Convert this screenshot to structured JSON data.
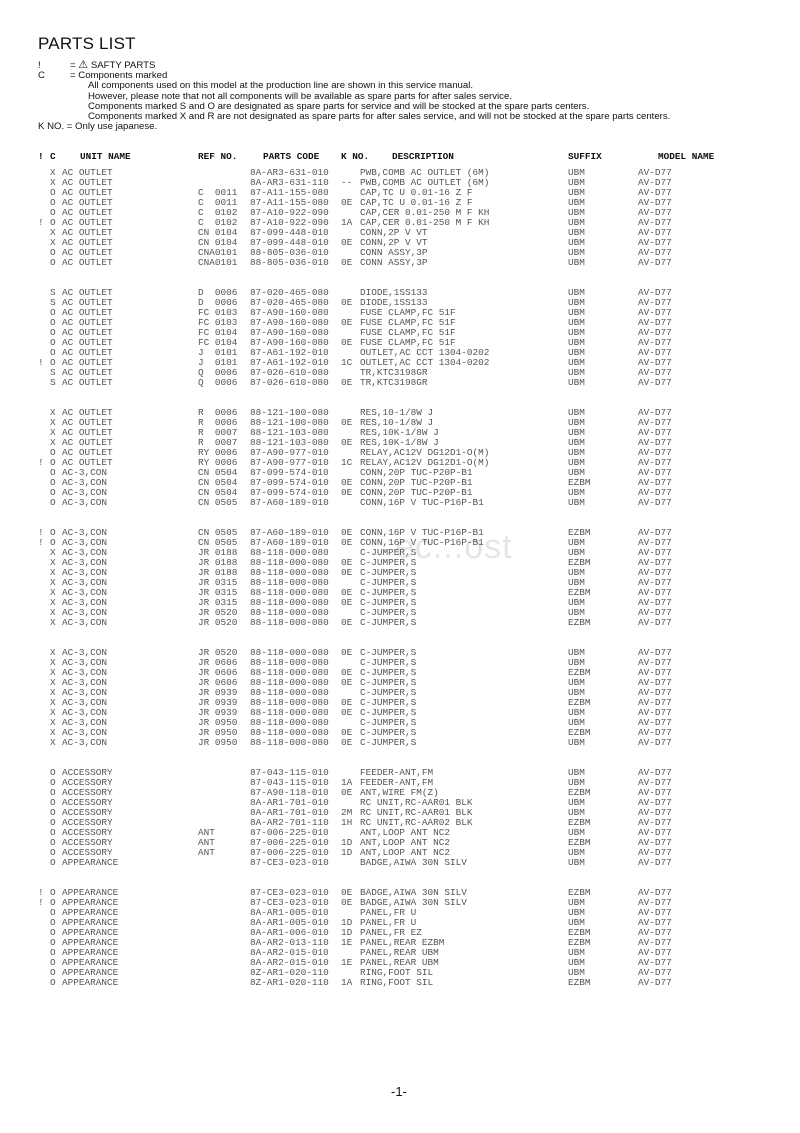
{
  "title": "PARTS LIST",
  "legend": {
    "safety_symbol": "!",
    "safety_def_prefix": "= ",
    "safety_icon": "warning-triangle",
    "safety_glyph": "⚠",
    "safety_label": "SAFTY PARTS",
    "c_symbol": "C",
    "c_def": "= Components marked",
    "notes": [
      "All components used on this model at the production line are shown in this service manual.",
      "However, please note that not all components will be available as spare parts for after sales service.",
      "Components marked S and O are designated as spare parts for service and will be stocked at the spare parts centers.",
      "Components marked X and R are not designated as spare parts for after sales service, and will not be stocked at the spare parts centers."
    ],
    "kno_note": "K NO. = Only use japanese."
  },
  "columns": {
    "bang": "!",
    "c": "C",
    "unit_name": "UNIT NAME",
    "ref_no": "REF NO.",
    "parts_code": "PARTS CODE",
    "k_no": "K NO.",
    "description": "DESCRIPTION",
    "suffix": "SUFFIX",
    "model_name": "MODEL NAME"
  },
  "groups": [
    {
      "rows": [
        {
          "bang": "",
          "c": "X",
          "unit": "AC OUTLET",
          "ref": "",
          "pc": "8A-AR3-631-010",
          "kno": "",
          "desc": "PWB,COMB AC OUTLET (6M)",
          "suf": "UBM",
          "model": "AV-D77"
        },
        {
          "bang": "",
          "c": "X",
          "unit": "AC OUTLET",
          "ref": "",
          "pc": "8A-AR3-631-110",
          "kno": "--",
          "desc": "PWB,COMB AC OUTLET (6M)",
          "suf": "UBM",
          "model": "AV-D77"
        },
        {
          "bang": "",
          "c": "O",
          "unit": "AC OUTLET",
          "ref": "C  0011",
          "pc": "87-A11-155-080",
          "kno": "",
          "desc": "CAP,TC U 0.01-16 Z F",
          "suf": "UBM",
          "model": "AV-D77"
        },
        {
          "bang": "",
          "c": "O",
          "unit": "AC OUTLET",
          "ref": "C  0011",
          "pc": "87-A11-155-080",
          "kno": "0E",
          "desc": "CAP,TC U 0.01-16 Z F",
          "suf": "UBM",
          "model": "AV-D77"
        },
        {
          "bang": "",
          "c": "O",
          "unit": "AC OUTLET",
          "ref": "C  0102",
          "pc": "87-A10-922-090",
          "kno": "",
          "desc": "CAP,CER 0.01-250 M F KH",
          "suf": "UBM",
          "model": "AV-D77"
        },
        {
          "bang": "!",
          "c": "O",
          "unit": "AC OUTLET",
          "ref": "C  0102",
          "pc": "87-A10-922-090",
          "kno": "1A",
          "desc": "CAP,CER 0.01-250 M F KH",
          "suf": "UBM",
          "model": "AV-D77"
        },
        {
          "bang": "",
          "c": "X",
          "unit": "AC OUTLET",
          "ref": "CN 0104",
          "pc": "87-099-448-010",
          "kno": "",
          "desc": "CONN,2P V VT",
          "suf": "UBM",
          "model": "AV-D77"
        },
        {
          "bang": "",
          "c": "X",
          "unit": "AC OUTLET",
          "ref": "CN 0104",
          "pc": "87-099-448-010",
          "kno": "0E",
          "desc": "CONN,2P V VT",
          "suf": "UBM",
          "model": "AV-D77"
        },
        {
          "bang": "",
          "c": "O",
          "unit": "AC OUTLET",
          "ref": "CNA0101",
          "pc": "88-805-036-010",
          "kno": "",
          "desc": "CONN ASSY,3P",
          "suf": "UBM",
          "model": "AV-D77"
        },
        {
          "bang": "",
          "c": "O",
          "unit": "AC OUTLET",
          "ref": "CNA0101",
          "pc": "88-805-036-010",
          "kno": "0E",
          "desc": "CONN ASSY,3P",
          "suf": "UBM",
          "model": "AV-D77"
        }
      ]
    },
    {
      "rows": [
        {
          "bang": "",
          "c": "S",
          "unit": "AC OUTLET",
          "ref": "D  0006",
          "pc": "87-020-465-080",
          "kno": "",
          "desc": "DIODE,1SS133",
          "suf": "UBM",
          "model": "AV-D77"
        },
        {
          "bang": "",
          "c": "S",
          "unit": "AC OUTLET",
          "ref": "D  0006",
          "pc": "87-020-465-080",
          "kno": "0E",
          "desc": "DIODE,1SS133",
          "suf": "UBM",
          "model": "AV-D77"
        },
        {
          "bang": "",
          "c": "O",
          "unit": "AC OUTLET",
          "ref": "FC 0103",
          "pc": "87-A90-160-080",
          "kno": "",
          "desc": "FUSE CLAMP,FC 51F",
          "suf": "UBM",
          "model": "AV-D77"
        },
        {
          "bang": "",
          "c": "O",
          "unit": "AC OUTLET",
          "ref": "FC 0103",
          "pc": "87-A90-160-080",
          "kno": "0E",
          "desc": "FUSE CLAMP,FC 51F",
          "suf": "UBM",
          "model": "AV-D77"
        },
        {
          "bang": "",
          "c": "O",
          "unit": "AC OUTLET",
          "ref": "FC 0104",
          "pc": "87-A90-160-080",
          "kno": "",
          "desc": "FUSE CLAMP,FC 51F",
          "suf": "UBM",
          "model": "AV-D77"
        },
        {
          "bang": "",
          "c": "O",
          "unit": "AC OUTLET",
          "ref": "FC 0104",
          "pc": "87-A90-160-080",
          "kno": "0E",
          "desc": "FUSE CLAMP,FC 51F",
          "suf": "UBM",
          "model": "AV-D77"
        },
        {
          "bang": "",
          "c": "O",
          "unit": "AC OUTLET",
          "ref": "J  0101",
          "pc": "87-A61-192-010",
          "kno": "",
          "desc": "OUTLET,AC CCT 1304-0202",
          "suf": "UBM",
          "model": "AV-D77"
        },
        {
          "bang": "!",
          "c": "O",
          "unit": "AC OUTLET",
          "ref": "J  0101",
          "pc": "87-A61-192-010",
          "kno": "1C",
          "desc": "OUTLET,AC CCT 1304-0202",
          "suf": "UBM",
          "model": "AV-D77"
        },
        {
          "bang": "",
          "c": "S",
          "unit": "AC OUTLET",
          "ref": "Q  0006",
          "pc": "87-026-610-080",
          "kno": "",
          "desc": "TR,KTC3198GR",
          "suf": "UBM",
          "model": "AV-D77"
        },
        {
          "bang": "",
          "c": "S",
          "unit": "AC OUTLET",
          "ref": "Q  0006",
          "pc": "87-026-610-080",
          "kno": "0E",
          "desc": "TR,KTC3198GR",
          "suf": "UBM",
          "model": "AV-D77"
        }
      ]
    },
    {
      "rows": [
        {
          "bang": "",
          "c": "X",
          "unit": "AC OUTLET",
          "ref": "R  0006",
          "pc": "88-121-100-080",
          "kno": "",
          "desc": "RES,10-1/8W J",
          "suf": "UBM",
          "model": "AV-D77"
        },
        {
          "bang": "",
          "c": "X",
          "unit": "AC OUTLET",
          "ref": "R  0006",
          "pc": "88-121-100-080",
          "kno": "0E",
          "desc": "RES,10-1/8W J",
          "suf": "UBM",
          "model": "AV-D77"
        },
        {
          "bang": "",
          "c": "X",
          "unit": "AC OUTLET",
          "ref": "R  0007",
          "pc": "88-121-103-080",
          "kno": "",
          "desc": "RES,10K-1/8W J",
          "suf": "UBM",
          "model": "AV-D77"
        },
        {
          "bang": "",
          "c": "X",
          "unit": "AC OUTLET",
          "ref": "R  0007",
          "pc": "88-121-103-080",
          "kno": "0E",
          "desc": "RES,10K-1/8W J",
          "suf": "UBM",
          "model": "AV-D77"
        },
        {
          "bang": "",
          "c": "O",
          "unit": "AC OUTLET",
          "ref": "RY 0006",
          "pc": "87-A90-977-010",
          "kno": "",
          "desc": "RELAY,AC12V DG12D1-O(M)",
          "suf": "UBM",
          "model": "AV-D77"
        },
        {
          "bang": "!",
          "c": "O",
          "unit": "AC OUTLET",
          "ref": "RY 0006",
          "pc": "87-A90-977-010",
          "kno": "1C",
          "desc": "RELAY,AC12V DG12D1-O(M)",
          "suf": "UBM",
          "model": "AV-D77"
        },
        {
          "bang": "",
          "c": "O",
          "unit": "AC-3,CON",
          "ref": "CN 0504",
          "pc": "87-099-574-010",
          "kno": "",
          "desc": "CONN,20P TUC-P20P-B1",
          "suf": "UBM",
          "model": "AV-D77"
        },
        {
          "bang": "",
          "c": "O",
          "unit": "AC-3,CON",
          "ref": "CN 0504",
          "pc": "87-099-574-010",
          "kno": "0E",
          "desc": "CONN,20P TUC-P20P-B1",
          "suf": "EZBM",
          "model": "AV-D77"
        },
        {
          "bang": "",
          "c": "O",
          "unit": "AC-3,CON",
          "ref": "CN 0504",
          "pc": "87-099-574-010",
          "kno": "0E",
          "desc": "CONN,20P TUC-P20P-B1",
          "suf": "UBM",
          "model": "AV-D77"
        },
        {
          "bang": "",
          "c": "O",
          "unit": "AC-3,CON",
          "ref": "CN 0505",
          "pc": "87-A60-189-010",
          "kno": "",
          "desc": "CONN,16P V TUC-P16P-B1",
          "suf": "UBM",
          "model": "AV-D77"
        }
      ]
    },
    {
      "rows": [
        {
          "bang": "!",
          "c": "O",
          "unit": "AC-3,CON",
          "ref": "CN 0505",
          "pc": "87-A60-189-010",
          "kno": "0E",
          "desc": "CONN,16P V TUC-P16P-B1",
          "suf": "EZBM",
          "model": "AV-D77"
        },
        {
          "bang": "!",
          "c": "O",
          "unit": "AC-3,CON",
          "ref": "CN 0505",
          "pc": "87-A60-189-010",
          "kno": "0E",
          "desc": "CONN,16P V TUC-P16P-B1",
          "suf": "UBM",
          "model": "AV-D77"
        },
        {
          "bang": "",
          "c": "X",
          "unit": "AC-3,CON",
          "ref": "JR 0188",
          "pc": "88-118-000-080",
          "kno": "",
          "desc": "C-JUMPER,S",
          "suf": "UBM",
          "model": "AV-D77"
        },
        {
          "bang": "",
          "c": "X",
          "unit": "AC-3,CON",
          "ref": "JR 0188",
          "pc": "88-118-000-080",
          "kno": "0E",
          "desc": "C-JUMPER,S",
          "suf": "EZBM",
          "model": "AV-D77"
        },
        {
          "bang": "",
          "c": "X",
          "unit": "AC-3,CON",
          "ref": "JR 0188",
          "pc": "88-118-000-080",
          "kno": "0E",
          "desc": "C-JUMPER,S",
          "suf": "UBM",
          "model": "AV-D77"
        },
        {
          "bang": "",
          "c": "X",
          "unit": "AC-3,CON",
          "ref": "JR 0315",
          "pc": "88-118-000-080",
          "kno": "",
          "desc": "C-JUMPER,S",
          "suf": "UBM",
          "model": "AV-D77"
        },
        {
          "bang": "",
          "c": "X",
          "unit": "AC-3,CON",
          "ref": "JR 0315",
          "pc": "88-118-000-080",
          "kno": "0E",
          "desc": "C-JUMPER,S",
          "suf": "EZBM",
          "model": "AV-D77"
        },
        {
          "bang": "",
          "c": "X",
          "unit": "AC-3,CON",
          "ref": "JR 0315",
          "pc": "88-118-000-080",
          "kno": "0E",
          "desc": "C-JUMPER,S",
          "suf": "UBM",
          "model": "AV-D77"
        },
        {
          "bang": "",
          "c": "X",
          "unit": "AC-3,CON",
          "ref": "JR 0520",
          "pc": "88-118-000-080",
          "kno": "",
          "desc": "C-JUMPER,S",
          "suf": "UBM",
          "model": "AV-D77"
        },
        {
          "bang": "",
          "c": "X",
          "unit": "AC-3,CON",
          "ref": "JR 0520",
          "pc": "88-118-000-080",
          "kno": "0E",
          "desc": "C-JUMPER,S",
          "suf": "EZBM",
          "model": "AV-D77"
        }
      ]
    },
    {
      "rows": [
        {
          "bang": "",
          "c": "X",
          "unit": "AC-3,CON",
          "ref": "JR 0520",
          "pc": "88-118-000-080",
          "kno": "0E",
          "desc": "C-JUMPER,S",
          "suf": "UBM",
          "model": "AV-D77"
        },
        {
          "bang": "",
          "c": "X",
          "unit": "AC-3,CON",
          "ref": "JR 0606",
          "pc": "88-118-000-080",
          "kno": "",
          "desc": "C-JUMPER,S",
          "suf": "UBM",
          "model": "AV-D77"
        },
        {
          "bang": "",
          "c": "X",
          "unit": "AC-3,CON",
          "ref": "JR 0606",
          "pc": "88-118-000-080",
          "kno": "0E",
          "desc": "C-JUMPER,S",
          "suf": "EZBM",
          "model": "AV-D77"
        },
        {
          "bang": "",
          "c": "X",
          "unit": "AC-3,CON",
          "ref": "JR 0606",
          "pc": "88-118-000-080",
          "kno": "0E",
          "desc": "C-JUMPER,S",
          "suf": "UBM",
          "model": "AV-D77"
        },
        {
          "bang": "",
          "c": "X",
          "unit": "AC-3,CON",
          "ref": "JR 0939",
          "pc": "88-118-000-080",
          "kno": "",
          "desc": "C-JUMPER,S",
          "suf": "UBM",
          "model": "AV-D77"
        },
        {
          "bang": "",
          "c": "X",
          "unit": "AC-3,CON",
          "ref": "JR 0939",
          "pc": "88-118-000-080",
          "kno": "0E",
          "desc": "C-JUMPER,S",
          "suf": "EZBM",
          "model": "AV-D77"
        },
        {
          "bang": "",
          "c": "X",
          "unit": "AC-3,CON",
          "ref": "JR 0939",
          "pc": "88-118-000-080",
          "kno": "0E",
          "desc": "C-JUMPER,S",
          "suf": "UBM",
          "model": "AV-D77"
        },
        {
          "bang": "",
          "c": "X",
          "unit": "AC-3,CON",
          "ref": "JR 0950",
          "pc": "88-118-000-080",
          "kno": "",
          "desc": "C-JUMPER,S",
          "suf": "UBM",
          "model": "AV-D77"
        },
        {
          "bang": "",
          "c": "X",
          "unit": "AC-3,CON",
          "ref": "JR 0950",
          "pc": "88-118-000-080",
          "kno": "0E",
          "desc": "C-JUMPER,S",
          "suf": "EZBM",
          "model": "AV-D77"
        },
        {
          "bang": "",
          "c": "X",
          "unit": "AC-3,CON",
          "ref": "JR 0950",
          "pc": "88-118-000-080",
          "kno": "0E",
          "desc": "C-JUMPER,S",
          "suf": "UBM",
          "model": "AV-D77"
        }
      ]
    },
    {
      "rows": [
        {
          "bang": "",
          "c": "O",
          "unit": "ACCESSORY",
          "ref": "",
          "pc": "87-043-115-010",
          "kno": "",
          "desc": "FEEDER-ANT,FM",
          "suf": "UBM",
          "model": "AV-D77"
        },
        {
          "bang": "",
          "c": "O",
          "unit": "ACCESSORY",
          "ref": "",
          "pc": "87-043-115-010",
          "kno": "1A",
          "desc": "FEEDER-ANT,FM",
          "suf": "UBM",
          "model": "AV-D77"
        },
        {
          "bang": "",
          "c": "O",
          "unit": "ACCESSORY",
          "ref": "",
          "pc": "87-A90-118-010",
          "kno": "0E",
          "desc": "ANT,WIRE FM(Z)",
          "suf": "EZBM",
          "model": "AV-D77"
        },
        {
          "bang": "",
          "c": "O",
          "unit": "ACCESSORY",
          "ref": "",
          "pc": "8A-AR1-701-010",
          "kno": "",
          "desc": "RC UNIT,RC-AAR01 BLK",
          "suf": "UBM",
          "model": "AV-D77"
        },
        {
          "bang": "",
          "c": "O",
          "unit": "ACCESSORY",
          "ref": "",
          "pc": "8A-AR1-701-010",
          "kno": "2M",
          "desc": "RC UNIT,RC-AAR01 BLK",
          "suf": "UBM",
          "model": "AV-D77"
        },
        {
          "bang": "",
          "c": "O",
          "unit": "ACCESSORY",
          "ref": "",
          "pc": "8A-AR2-701-110",
          "kno": "1H",
          "desc": "RC UNIT,RC-AAR02 BLK",
          "suf": "EZBM",
          "model": "AV-D77"
        },
        {
          "bang": "",
          "c": "O",
          "unit": "ACCESSORY",
          "ref": "ANT",
          "pc": "87-006-225-010",
          "kno": "",
          "desc": "ANT,LOOP ANT NC2",
          "suf": "UBM",
          "model": "AV-D77"
        },
        {
          "bang": "",
          "c": "O",
          "unit": "ACCESSORY",
          "ref": "ANT",
          "pc": "87-006-225-010",
          "kno": "1D",
          "desc": "ANT,LOOP ANT NC2",
          "suf": "EZBM",
          "model": "AV-D77"
        },
        {
          "bang": "",
          "c": "O",
          "unit": "ACCESSORY",
          "ref": "ANT",
          "pc": "87-006-225-010",
          "kno": "1D",
          "desc": "ANT,LOOP ANT NC2",
          "suf": "UBM",
          "model": "AV-D77"
        },
        {
          "bang": "",
          "c": "O",
          "unit": "APPEARANCE",
          "ref": "",
          "pc": "87-CE3-023-010",
          "kno": "",
          "desc": "BADGE,AIWA 30N SILV",
          "suf": "UBM",
          "model": "AV-D77"
        }
      ]
    },
    {
      "rows": [
        {
          "bang": "!",
          "c": "O",
          "unit": "APPEARANCE",
          "ref": "",
          "pc": "87-CE3-023-010",
          "kno": "0E",
          "desc": "BADGE,AIWA 30N SILV",
          "suf": "EZBM",
          "model": "AV-D77"
        },
        {
          "bang": "!",
          "c": "O",
          "unit": "APPEARANCE",
          "ref": "",
          "pc": "87-CE3-023-010",
          "kno": "0E",
          "desc": "BADGE,AIWA 30N SILV",
          "suf": "UBM",
          "model": "AV-D77"
        },
        {
          "bang": "",
          "c": "O",
          "unit": "APPEARANCE",
          "ref": "",
          "pc": "8A-AR1-005-010",
          "kno": "",
          "desc": "PANEL,FR U",
          "suf": "UBM",
          "model": "AV-D77"
        },
        {
          "bang": "",
          "c": "O",
          "unit": "APPEARANCE",
          "ref": "",
          "pc": "8A-AR1-005-010",
          "kno": "1D",
          "desc": "PANEL,FR U",
          "suf": "UBM",
          "model": "AV-D77"
        },
        {
          "bang": "",
          "c": "O",
          "unit": "APPEARANCE",
          "ref": "",
          "pc": "8A-AR1-006-010",
          "kno": "1D",
          "desc": "PANEL,FR EZ",
          "suf": "EZBM",
          "model": "AV-D77"
        },
        {
          "bang": "",
          "c": "O",
          "unit": "APPEARANCE",
          "ref": "",
          "pc": "8A-AR2-013-110",
          "kno": "1E",
          "desc": "PANEL,REAR EZBM",
          "suf": "EZBM",
          "model": "AV-D77"
        },
        {
          "bang": "",
          "c": "O",
          "unit": "APPEARANCE",
          "ref": "",
          "pc": "8A-AR2-015-010",
          "kno": "",
          "desc": "PANEL,REAR UBM",
          "suf": "UBM",
          "model": "AV-D77"
        },
        {
          "bang": "",
          "c": "O",
          "unit": "APPEARANCE",
          "ref": "",
          "pc": "8A-AR2-015-010",
          "kno": "1E",
          "desc": "PANEL,REAR UBM",
          "suf": "UBM",
          "model": "AV-D77"
        },
        {
          "bang": "",
          "c": "O",
          "unit": "APPEARANCE",
          "ref": "",
          "pc": "8Z-AR1-020-110",
          "kno": "",
          "desc": "RING,FOOT SIL",
          "suf": "UBM",
          "model": "AV-D77"
        },
        {
          "bang": "",
          "c": "O",
          "unit": "APPEARANCE",
          "ref": "",
          "pc": "8Z-AR1-020-110",
          "kno": "1A",
          "desc": "RING,FOOT SIL",
          "suf": "EZBM",
          "model": "AV-D77"
        }
      ]
    }
  ],
  "watermark": "ec...ost",
  "page_number": "-1-"
}
